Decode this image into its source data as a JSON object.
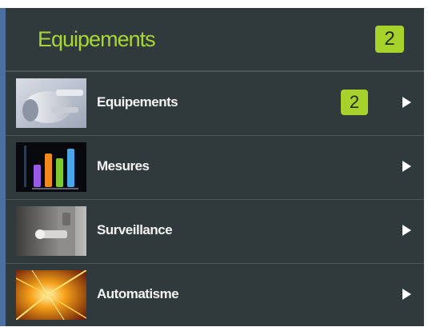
{
  "header": {
    "title": "Equipements",
    "badge": "2"
  },
  "menu": {
    "items": [
      {
        "label": "Equipements",
        "badge": "2",
        "thumbnail": "power-plug-image",
        "arrow_icon": "arrow-right-icon"
      },
      {
        "label": "Mesures",
        "thumbnail": "bar-meter-image",
        "arrow_icon": "arrow-right-icon"
      },
      {
        "label": "Surveillance",
        "thumbnail": "door-lock-image",
        "arrow_icon": "arrow-right-icon"
      },
      {
        "label": "Automatisme",
        "thumbnail": "light-burst-image",
        "arrow_icon": "arrow-right-icon"
      }
    ]
  },
  "colors": {
    "panel_background": "#303a3d",
    "accent_green": "#a7d12b",
    "title_green": "#a8d633",
    "left_border": "#4a6fa3"
  }
}
